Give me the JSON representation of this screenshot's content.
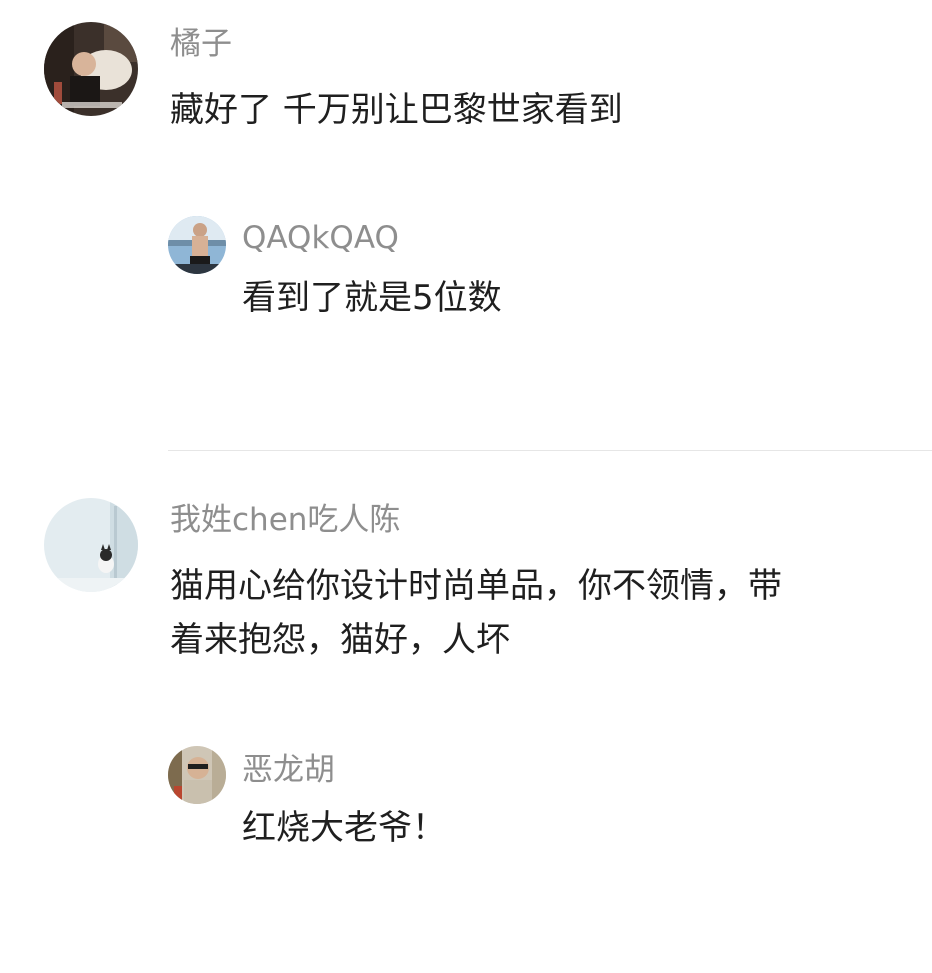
{
  "thread1": {
    "comment": {
      "avatar_icon": "person-with-dog-avatar-icon",
      "username": "橘子",
      "text": "藏好了 千万别让巴黎世家看到"
    },
    "reply": {
      "avatar_icon": "person-at-beach-avatar-icon",
      "username": "QAQkQAQ",
      "text": "看到了就是5位数"
    }
  },
  "thread2": {
    "comment": {
      "avatar_icon": "cat-at-window-avatar-icon",
      "username": "我姓chen吃人陈",
      "text_line1": "猫用心给你设计时尚单品，你不领情，带",
      "text_line2": "着来抱怨，猫好，人坏"
    },
    "reply": {
      "avatar_icon": "person-with-sunglasses-avatar-icon",
      "username": "恶龙胡",
      "text": "红烧大老爷！"
    }
  },
  "colors": {
    "username": "#8e8e8e",
    "text": "#1f1f1f",
    "divider": "#e6e6e6",
    "background": "#ffffff"
  }
}
